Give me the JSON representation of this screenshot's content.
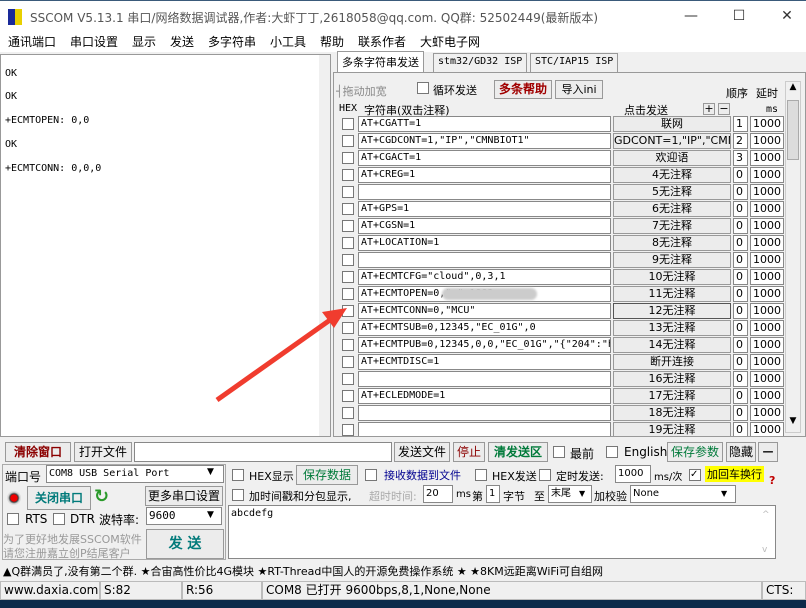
{
  "window": {
    "title": "SSCOM V5.13.1 串口/网络数据调试器,作者:大虾丁丁,2618058@qq.com. QQ群: 52502449(最新版本)",
    "min": "—",
    "max": "☐",
    "close": "✕"
  },
  "menu": [
    "通讯端口",
    "串口设置",
    "显示",
    "发送",
    "多字符串",
    "小工具",
    "帮助",
    "联系作者",
    "大虾电子网"
  ],
  "receive": {
    "lines": [
      "OK",
      "OK",
      "+ECMTOPEN: 0,0",
      "OK",
      "+ECMTCONN: 0,0,0"
    ]
  },
  "tabs": [
    "多条字符串发送",
    "stm32/GD32 ISP",
    "STC/IAP15 ISP"
  ],
  "multi": {
    "drag_label": "┤拖动加宽",
    "loop_send": "循环发送",
    "help": "多条帮助",
    "import": "导入ini",
    "order": "顺序",
    "delay": "延时",
    "hex": "HEX",
    "string_header": "字符串(双击注释)",
    "click_send": "点击发送",
    "plus": "+",
    "minus": "−",
    "ms": "ms",
    "rows": [
      {
        "text": "AT+CGATT=1",
        "button": "联网",
        "order": "1",
        "delay": "1000"
      },
      {
        "text": "AT+CGDCONT=1,\"IP\",\"CMNBIOT1\"",
        "button": "GDCONT=1,\"IP\",\"CMNBI",
        "order": "2",
        "delay": "1000"
      },
      {
        "text": "AT+CGACT=1",
        "button": "欢迎语",
        "order": "3",
        "delay": "1000"
      },
      {
        "text": "AT+CREG=1",
        "button": "4无注释",
        "order": "0",
        "delay": "1000"
      },
      {
        "text": "",
        "button": "5无注释",
        "order": "0",
        "delay": "1000"
      },
      {
        "text": "AT+GPS=1",
        "button": "6无注释",
        "order": "0",
        "delay": "1000"
      },
      {
        "text": "AT+CGSN=1",
        "button": "7无注释",
        "order": "0",
        "delay": "1000"
      },
      {
        "text": "AT+LOCATION=1",
        "button": "8无注释",
        "order": "0",
        "delay": "1000"
      },
      {
        "text": "",
        "button": "9无注释",
        "order": "0",
        "delay": "1000"
      },
      {
        "text": "AT+ECMTCFG=\"cloud\",0,3,1",
        "button": "10无注释",
        "order": "0",
        "delay": "1000"
      },
      {
        "text": "AT+ECMTOPEN=0,\"            \",1883",
        "button": "11无注释",
        "order": "0",
        "delay": "1000"
      },
      {
        "text": "AT+ECMTCONN=0,\"MCU\"",
        "button": "12无注释",
        "order": "0",
        "delay": "1000"
      },
      {
        "text": "AT+ECMTSUB=0,12345,\"EC_01G\",0",
        "button": "13无注释",
        "order": "0",
        "delay": "1000"
      },
      {
        "text": "AT+ECMTPUB=0,12345,0,0,\"EC_01G\",\"{\"204\":\"h",
        "button": "14无注释",
        "order": "0",
        "delay": "1000"
      },
      {
        "text": "AT+ECMTDISC=1",
        "button": "断开连接",
        "order": "0",
        "delay": "1000"
      },
      {
        "text": "",
        "button": "16无注释",
        "order": "0",
        "delay": "1000"
      },
      {
        "text": "AT+ECLEDMODE=1",
        "button": "17无注释",
        "order": "0",
        "delay": "1000"
      },
      {
        "text": "",
        "button": "18无注释",
        "order": "0",
        "delay": "1000"
      },
      {
        "text": "",
        "button": "19无注释",
        "order": "0",
        "delay": "1000"
      }
    ]
  },
  "toolbar": {
    "clear": "清除窗口",
    "open_file": "打开文件",
    "file_path": "",
    "send_file": "发送文件",
    "stop": "停止",
    "clear_send": "清发送区",
    "topmost": "最前",
    "english": "English",
    "save_params": "保存参数",
    "hide": "隐藏",
    "dash": "—"
  },
  "port": {
    "label": "端口号",
    "value": "COM8 USB Serial Port",
    "close_port": "关闭串口",
    "more": "更多串口设置",
    "rts": "RTS",
    "dtr": "DTR",
    "baud_label": "波特率:",
    "baud": "9600",
    "promo1": "为了更好地发展SSCOM软件",
    "promo2": "请您注册嘉立创P结尾客户",
    "send": "发 送"
  },
  "options": {
    "hex_show": "HEX显示",
    "save_data": "保存数据",
    "recv_to_file": "接收数据到文件",
    "hex_send": "HEX发送",
    "timed_send": "定时发送:",
    "interval": "1000",
    "interval_unit": "ms/次",
    "add_crlf": "加回车换行",
    "add_crlf_checked": true,
    "timestamp": "加时间戳和分包显示,",
    "timeout_label": "超时时间:",
    "timeout": "20",
    "timeout_unit": "ms",
    "nth": "第",
    "byte_from": "1",
    "byte_label": "字节",
    "to": "至",
    "end": "末尾",
    "checksum_label": "加校验",
    "checksum": "None",
    "help_q": "?"
  },
  "send_text": "abcdefg",
  "ticker": "▲Q群满员了,没有第二个群. ★合宙高性价比4G模块 ★RT-Thread中国人的开源免费操作系统 ★ ★8KM远距离WiFi可自组网",
  "status": {
    "site": "www.daxia.com",
    "sent": "S:82",
    "recv": "R:56",
    "port_state": "COM8 已打开  9600bps,8,1,None,None",
    "cts": "CTS:"
  },
  "colors": {
    "clear_red": "#8b0000",
    "green_text": "#007a3a",
    "crlf_bg": "#ffff00",
    "help_red": "#a00000",
    "arrow": "#f03c2e",
    "ticker_blue": "#0000c0"
  }
}
